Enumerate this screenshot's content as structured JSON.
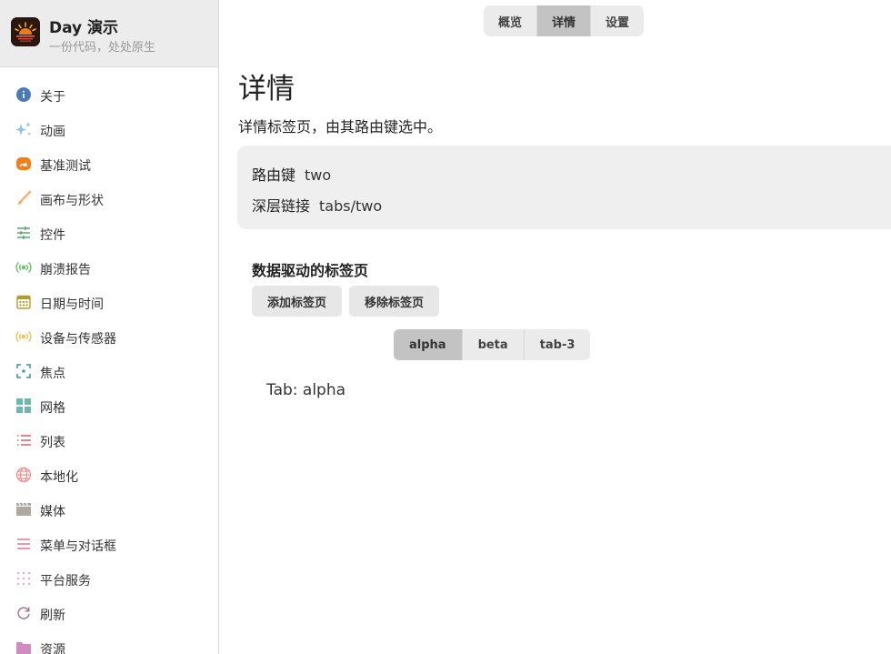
{
  "sidebar": {
    "app_name": "Day 演示",
    "app_subtitle": "一份代码，处处原生",
    "items": [
      {
        "label": "关于",
        "icon": "info-icon",
        "color": "#4a7bb7"
      },
      {
        "label": "动画",
        "icon": "sparkles-icon",
        "color": "#8ec3e6"
      },
      {
        "label": "基准测试",
        "icon": "speedometer-icon",
        "color": "#f07f1a"
      },
      {
        "label": "画布与形状",
        "icon": "paintbrush-icon",
        "color": "#f2b07a"
      },
      {
        "label": "控件",
        "icon": "sliders-icon",
        "color": "#5aa86a"
      },
      {
        "label": "崩溃报告",
        "icon": "broadcast-icon",
        "color": "#6bc06b"
      },
      {
        "label": "日期与时间",
        "icon": "calendar-icon",
        "color": "#b59a2e"
      },
      {
        "label": "设备与传感器",
        "icon": "sensor-icon",
        "color": "#e8c55a"
      },
      {
        "label": "焦点",
        "icon": "focus-icon",
        "color": "#3c8e9e"
      },
      {
        "label": "网格",
        "icon": "grid-icon",
        "color": "#6fb8b0"
      },
      {
        "label": "列表",
        "icon": "list-icon",
        "color": "#e0505a"
      },
      {
        "label": "本地化",
        "icon": "globe-icon",
        "color": "#f08a8a"
      },
      {
        "label": "媒体",
        "icon": "clapperboard-icon",
        "color": "#b0a8a0"
      },
      {
        "label": "菜单与对话框",
        "icon": "menu-icon",
        "color": "#e06a8a"
      },
      {
        "label": "平台服务",
        "icon": "dots-grid-icon",
        "color": "#f0a8c0"
      },
      {
        "label": "刷新",
        "icon": "refresh-icon",
        "color": "#a07090"
      },
      {
        "label": "资源",
        "icon": "folder-icon",
        "color": "#d08cc0"
      }
    ]
  },
  "top_tabs": [
    {
      "label": "概览",
      "active": false
    },
    {
      "label": "详情",
      "active": true
    },
    {
      "label": "设置",
      "active": false
    }
  ],
  "page": {
    "title": "详情",
    "description": "详情标签页，由其路由键选中。",
    "route_key_label": "路由键",
    "route_key_value": "two",
    "deep_link_label": "深层链接",
    "deep_link_value": "tabs/two"
  },
  "data_tabs_section": {
    "title": "数据驱动的标签页",
    "add_button": "添加标签页",
    "remove_button": "移除标签页",
    "tabs": [
      {
        "label": "alpha",
        "active": true
      },
      {
        "label": "beta",
        "active": false
      },
      {
        "label": "tab-3",
        "active": false
      }
    ],
    "content": "Tab: alpha"
  }
}
